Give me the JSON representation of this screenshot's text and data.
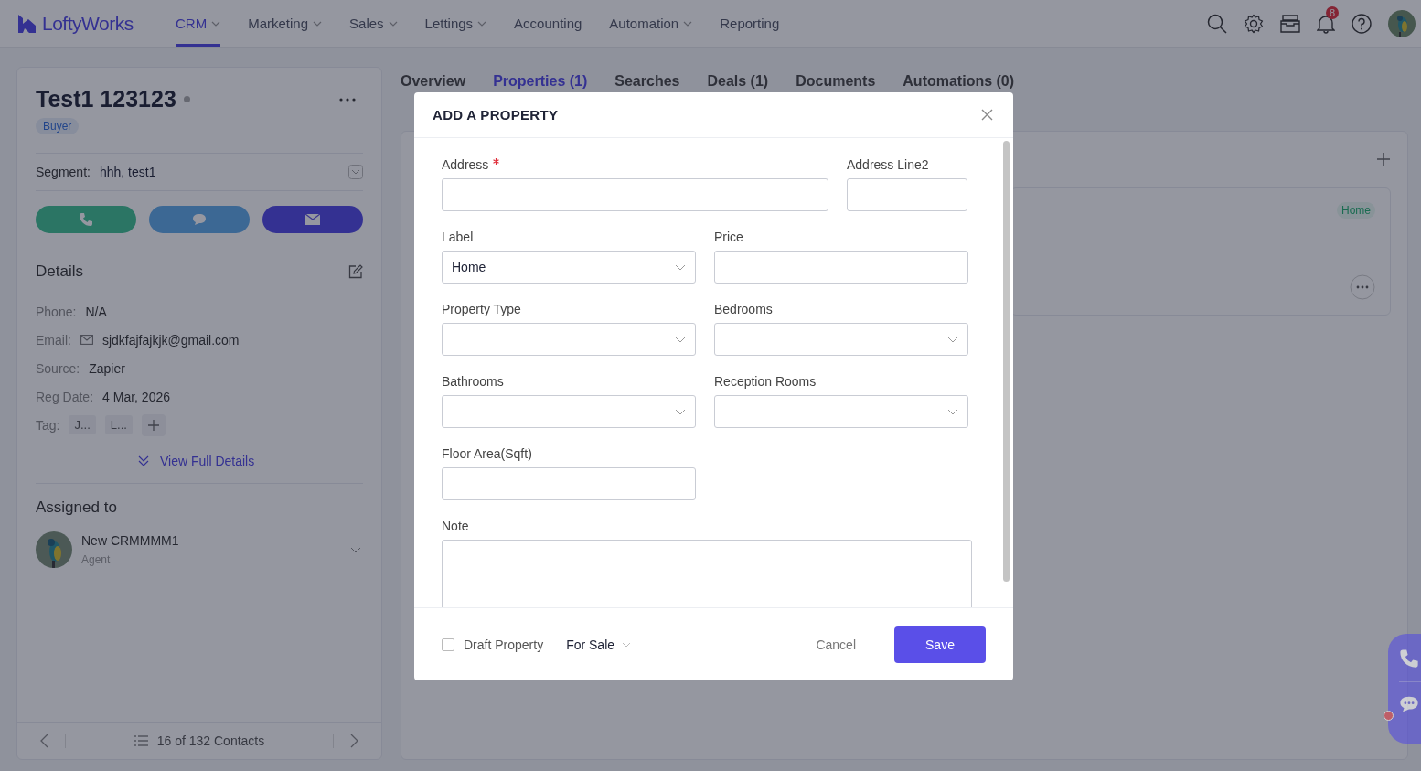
{
  "nav": {
    "logo": "LoftyWorks",
    "items": [
      {
        "label": "CRM",
        "selected": true,
        "has_menu": true
      },
      {
        "label": "Marketing",
        "selected": false,
        "has_menu": true
      },
      {
        "label": "Sales",
        "selected": false,
        "has_menu": true
      },
      {
        "label": "Lettings",
        "selected": false,
        "has_menu": true
      },
      {
        "label": "Accounting",
        "selected": false,
        "has_menu": false
      },
      {
        "label": "Automation",
        "selected": false,
        "has_menu": true
      },
      {
        "label": "Reporting",
        "selected": false,
        "has_menu": false
      }
    ],
    "notification_count": "8"
  },
  "contact": {
    "name": "Test1 123123",
    "role": "Buyer",
    "segment_label": "Segment:",
    "segment_value": "hhh, test1",
    "details_title": "Details",
    "fields": [
      {
        "label": "Phone:",
        "value": "N/A",
        "kind": "text"
      },
      {
        "label": "Email:",
        "value": "sjdkfajfajkjk@gmail.com",
        "kind": "email"
      },
      {
        "label": "Source:",
        "value": "Zapier",
        "kind": "text"
      },
      {
        "label": "Reg Date:",
        "value": "4 Mar, 2026",
        "kind": "text"
      }
    ],
    "tag_label": "Tag:",
    "tags": [
      "J...",
      "L..."
    ],
    "view_full": "View Full Details",
    "assigned_title": "Assigned to",
    "assignee": {
      "name": "New CRMMMM1",
      "role": "Agent"
    },
    "pager": "16 of 132 Contacts"
  },
  "tabs": [
    {
      "label": "Overview",
      "selected": false
    },
    {
      "label": "Properties (1)",
      "selected": true
    },
    {
      "label": "Searches",
      "selected": false
    },
    {
      "label": "Deals (1)",
      "selected": false
    },
    {
      "label": "Documents",
      "selected": false
    },
    {
      "label": "Automations (0)",
      "selected": false
    }
  ],
  "property_card": {
    "tag": "Home"
  },
  "modal": {
    "title": "ADD A PROPERTY",
    "rows": [
      [
        {
          "label": "Address",
          "required": true,
          "kind": "text"
        },
        {
          "label": "Address Line2",
          "required": false,
          "kind": "text"
        }
      ],
      [
        {
          "label": "Label",
          "required": false,
          "kind": "select",
          "value": "Home"
        },
        {
          "label": "Price",
          "required": false,
          "kind": "text"
        }
      ],
      [
        {
          "label": "Property Type",
          "required": false,
          "kind": "select"
        },
        {
          "label": "Bedrooms",
          "required": false,
          "kind": "select"
        }
      ],
      [
        {
          "label": "Bathrooms",
          "required": false,
          "kind": "select"
        },
        {
          "label": "Reception Rooms",
          "required": false,
          "kind": "select"
        }
      ],
      [
        {
          "label": "Floor Area(Sqft)",
          "required": false,
          "kind": "text"
        }
      ]
    ],
    "note_label": "Note",
    "draft": {
      "label": "Draft Property",
      "checked": false
    },
    "status": "For Sale",
    "cancel": "Cancel",
    "save": "Save"
  }
}
